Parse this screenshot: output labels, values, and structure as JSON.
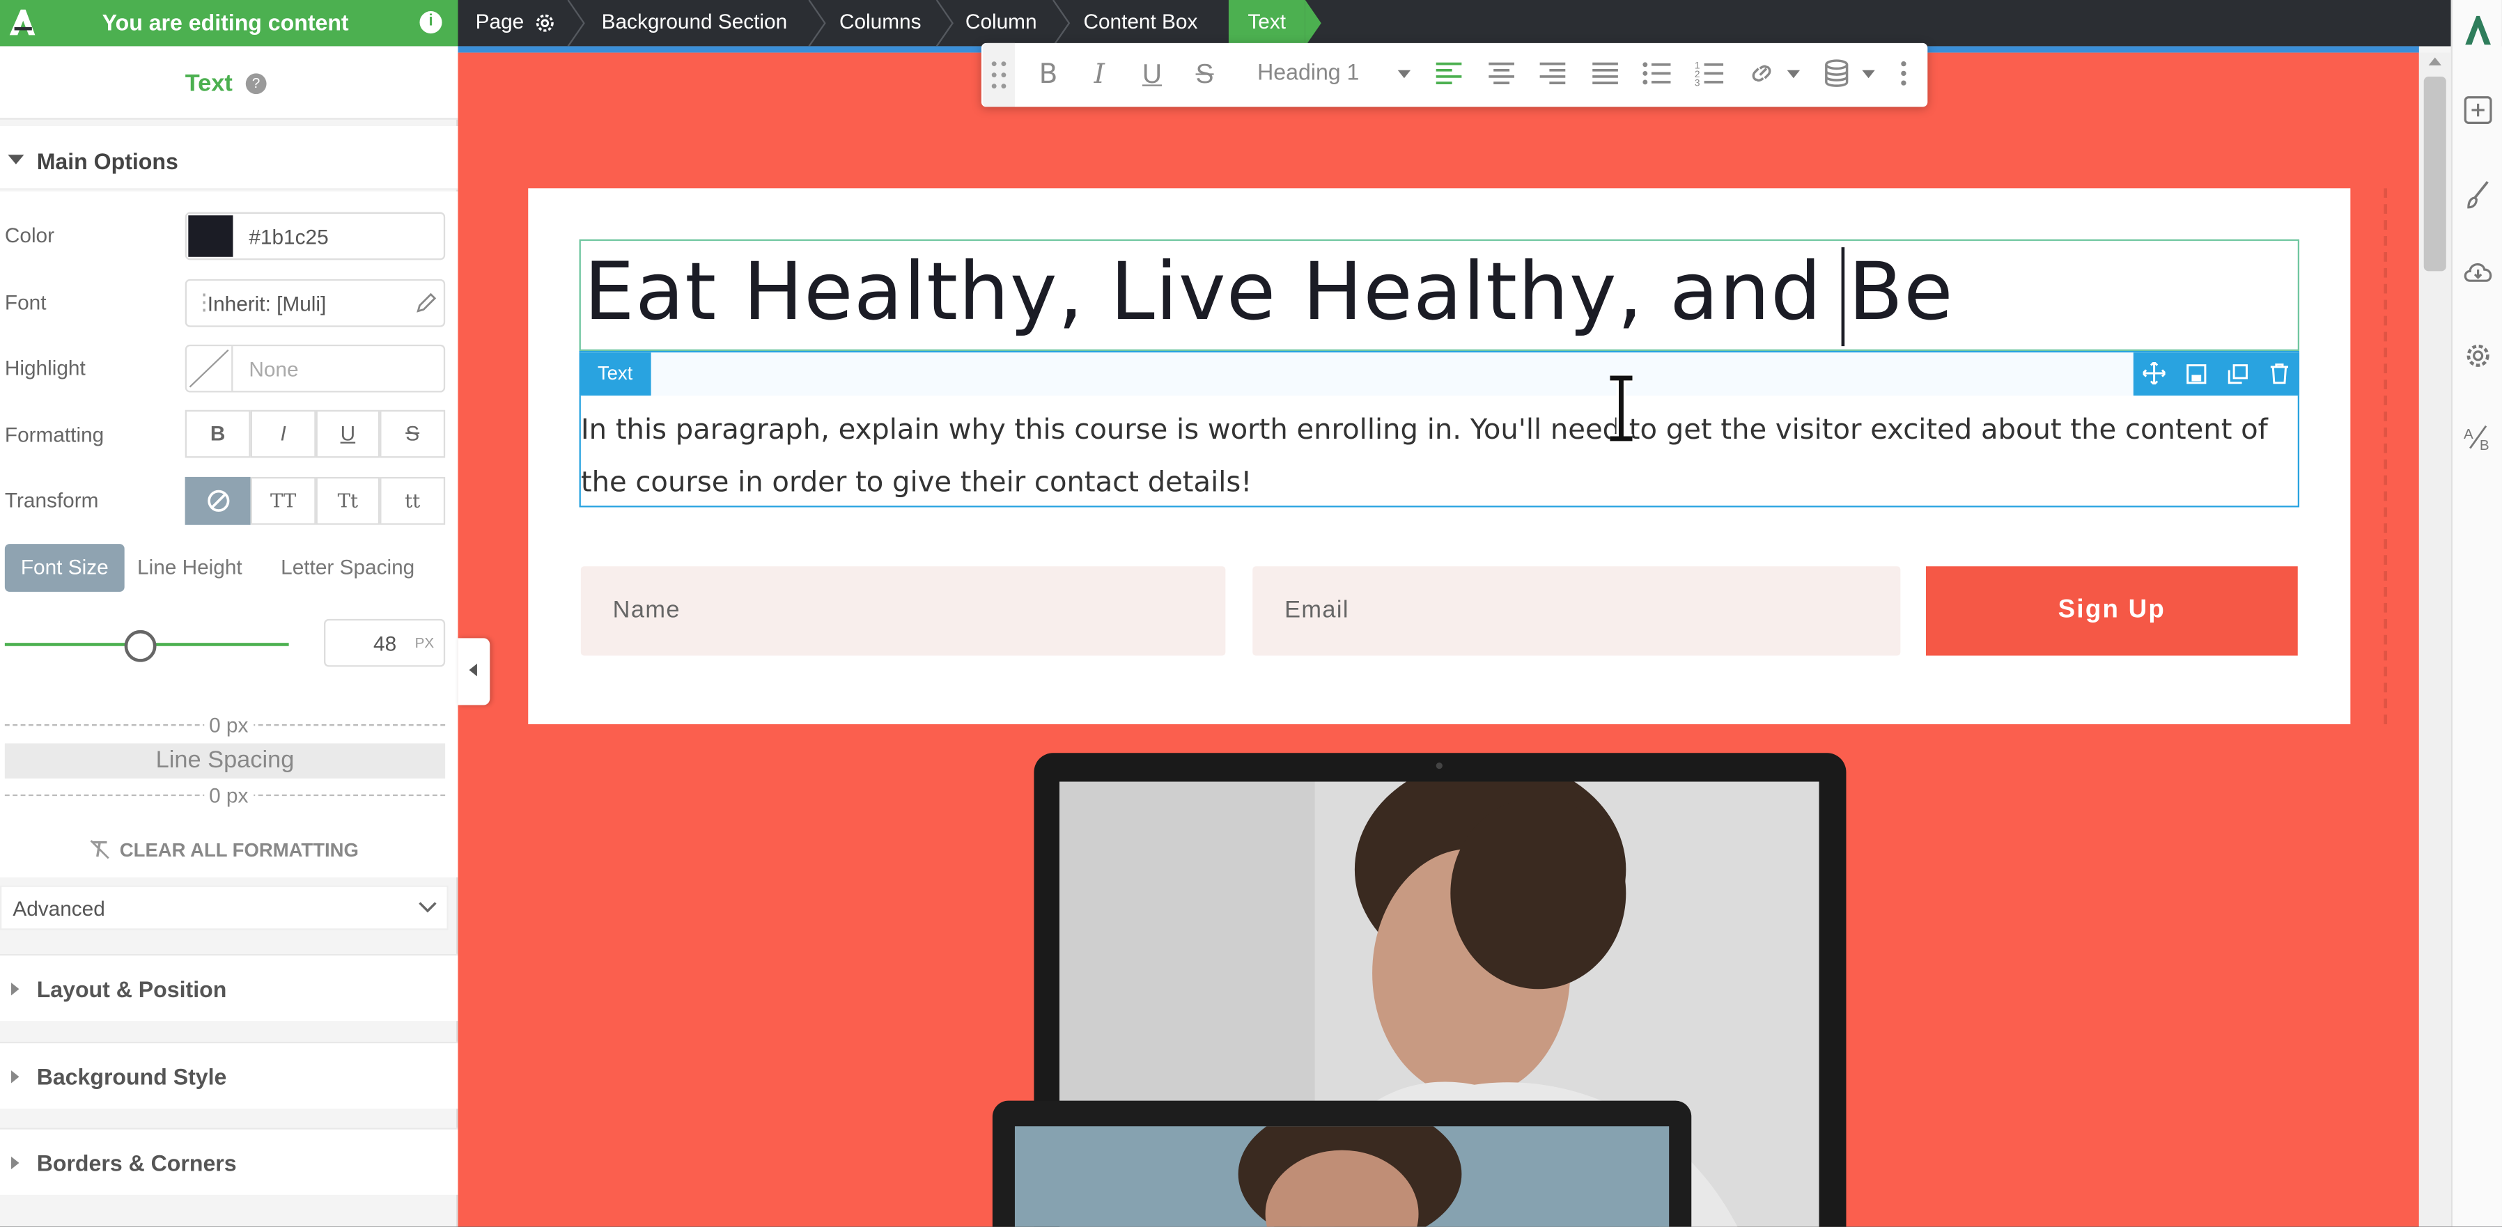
{
  "topbar": {
    "editing_label": "You are editing content",
    "breadcrumbs": [
      "Page",
      "Background Section",
      "Columns",
      "Column",
      "Content Box",
      "Text"
    ]
  },
  "toolbar": {
    "block_style": "Heading 1",
    "buttons": [
      "bold-icon",
      "italic-icon",
      "underline-icon",
      "strikethrough-icon",
      "align-left-icon",
      "align-center-icon",
      "align-right-icon",
      "justify-icon",
      "bullet-list-icon",
      "numbered-list-icon",
      "link-icon",
      "database-icon",
      "more-icon"
    ]
  },
  "panel": {
    "title": "Text",
    "main_options": "Main Options",
    "color_label": "Color",
    "color_value": "#1b1c25",
    "font_label": "Font",
    "font_value": "Inherit: [Muli]",
    "highlight_label": "Highlight",
    "highlight_value": "None",
    "formatting_label": "Formatting",
    "formatting": [
      "B",
      "I",
      "U",
      "S"
    ],
    "transform_label": "Transform",
    "transform": [
      "TT",
      "Tt",
      "tt"
    ],
    "tabs": [
      "Font Size",
      "Line Height",
      "Letter Spacing"
    ],
    "font_size": "48",
    "font_size_unit": "PX",
    "font_size_fraction": 0.47,
    "spacing_top": "0 px",
    "line_spacing_label": "Line Spacing",
    "spacing_bottom": "0 px",
    "clear_formatting": "CLEAR ALL FORMATTING",
    "advanced": "Advanced",
    "sections": [
      "Layout & Position",
      "Background Style",
      "Borders & Corners"
    ]
  },
  "canvas": {
    "heading": "Eat Healthy, Live Healthy, and Be",
    "element_tag": "Text",
    "paragraph": "In this paragraph, explain why this course is worth enrolling in. You'll need to get the visitor excited about the content of the course in order to give their contact details!",
    "name_placeholder": "Name",
    "email_placeholder": "Email",
    "signup_label": "Sign Up"
  },
  "colors": {
    "green": "#4cb050",
    "canvas_bg": "#fb5f4e",
    "button": "#f55846",
    "selection_blue": "#29a3e0",
    "text": "#1b1c25"
  }
}
